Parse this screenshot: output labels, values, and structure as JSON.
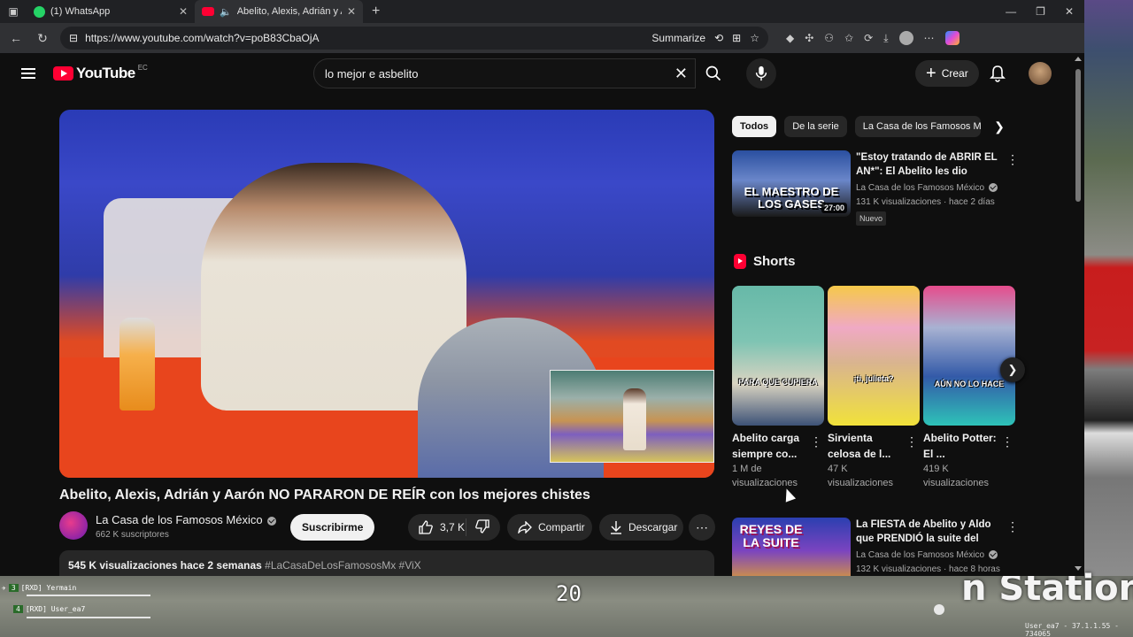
{
  "tabs": [
    {
      "title": "(1) WhatsApp"
    },
    {
      "title": "Abelito, Alexis, Adrián y Aarón"
    }
  ],
  "address": {
    "url": "https://www.youtube.com/watch?v=poB83CbaOjA",
    "summarize": "Summarize"
  },
  "header": {
    "logo_text": "YouTube",
    "country": "EC",
    "search_value": "lo mejor e asbelito",
    "create_label": "Crear"
  },
  "video": {
    "title": "Abelito, Alexis, Adrián y Aarón NO PARARON DE REÍR con los mejores chistes",
    "channel": "La Casa de los Famosos México",
    "subscribers": "662 K suscriptores",
    "subscribe_label": "Suscribirme",
    "likes": "3,7 K",
    "share_label": "Compartir",
    "download_label": "Descargar",
    "description_stats": "545 K visualizaciones  hace 2 semanas",
    "description_tags": "#LaCasaDeLosFamososMx #ViX"
  },
  "chips": [
    "Todos",
    "De la serie",
    "La Casa de los Famosos M"
  ],
  "recommendations": [
    {
      "title": "\"Estoy tratando de ABRIR EL AN*\": El Abelito les dio clases ...",
      "channel": "La Casa de los Famosos México",
      "stats": "131 K visualizaciones · hace 2 días",
      "badge": "Nuevo",
      "duration": "27:00",
      "thumb_text": "EL MAESTRO DE LOS GASES"
    },
    {
      "title": "La FIESTA de Abelito y Aldo que PRENDIÓ la suite del líder en L...",
      "channel": "La Casa de los Famosos México",
      "stats": "132 K visualizaciones · hace 8 horas",
      "badge": "",
      "duration": "",
      "thumb_text": "REYES DE LA SUITE"
    }
  ],
  "shorts": {
    "heading": "Shorts",
    "items": [
      {
        "title": "Abelito carga siempre co...",
        "views": "1 M de visualizaciones",
        "caption": "PARA QUE CUPIERA"
      },
      {
        "title": "Sirvienta celosa de l...",
        "views": "47 K visualizaciones",
        "caption": "¡ti, julieta?"
      },
      {
        "title": "Abelito Potter: El ...",
        "views": "419 K visualizaciones",
        "caption": "AÚN NO LO HACE"
      }
    ]
  },
  "game_hud": {
    "player1": "[RXD] Yermain",
    "player1_num": "3",
    "player2": "[RXD] User_ea7",
    "player2_num": "4",
    "counter": "20",
    "station": "n Station",
    "version": "User_ea7 - 37.1.1.55 - 734065"
  }
}
